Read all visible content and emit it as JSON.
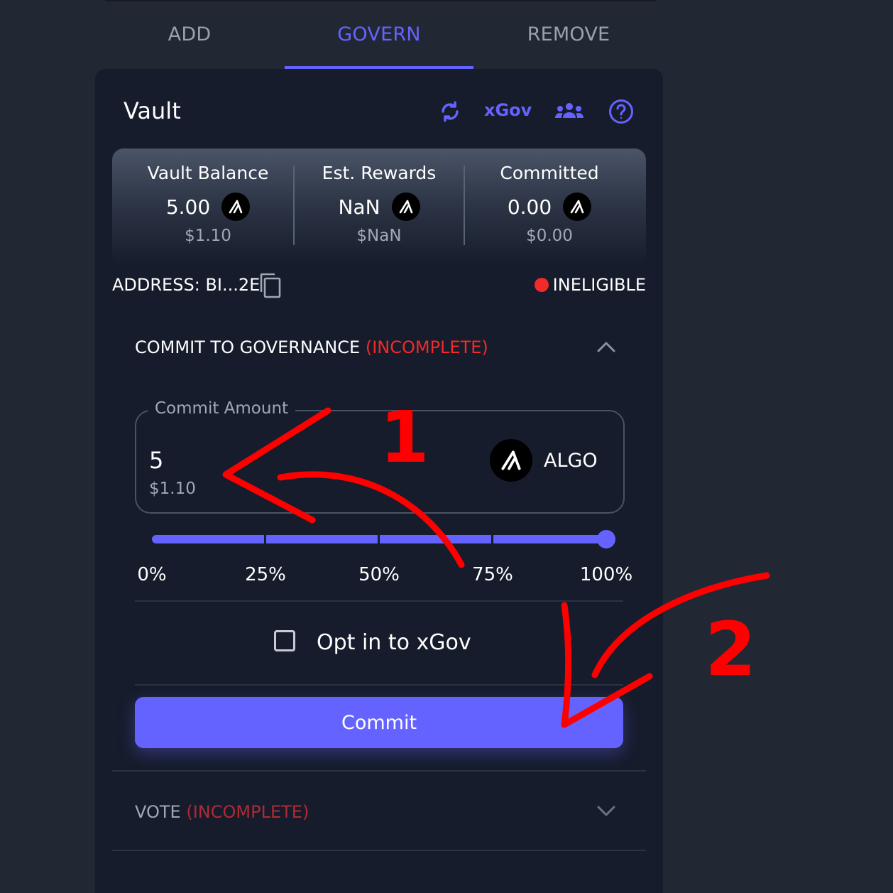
{
  "tabs": [
    {
      "label": "ADD",
      "active": false
    },
    {
      "label": "GOVERN",
      "active": true
    },
    {
      "label": "REMOVE",
      "active": false
    }
  ],
  "header": {
    "title": "Vault",
    "xgov_label": "xGov"
  },
  "stats": [
    {
      "label": "Vault Balance",
      "value": "5.00",
      "usd": "$1.10"
    },
    {
      "label": "Est. Rewards",
      "value": "NaN",
      "usd": "$NaN"
    },
    {
      "label": "Committed",
      "value": "0.00",
      "usd": "$0.00"
    }
  ],
  "address": {
    "text": "ADDRESS: BI...2E"
  },
  "status": {
    "text": "INELIGIBLE",
    "color": "#f22a2a"
  },
  "commit_section": {
    "title": "COMMIT TO GOVERNANCE",
    "status": "(INCOMPLETE)",
    "amount_label": "Commit Amount",
    "amount_value": "5",
    "amount_usd": "$1.10",
    "unit": "ALGO",
    "slider_percent": 100,
    "slider_labels": [
      "0%",
      "25%",
      "50%",
      "75%",
      "100%"
    ],
    "opt_in_label": "Opt in to xGov",
    "opt_in_checked": false,
    "button_label": "Commit"
  },
  "vote_section": {
    "title": "VOTE",
    "status": "(INCOMPLETE)"
  },
  "annotations": {
    "label_1": "1",
    "label_2": "2",
    "color": "#ff0000"
  },
  "colors": {
    "accent": "#6563ff",
    "background": "#222833",
    "card": "#161c2b",
    "error": "#f22a2a"
  }
}
